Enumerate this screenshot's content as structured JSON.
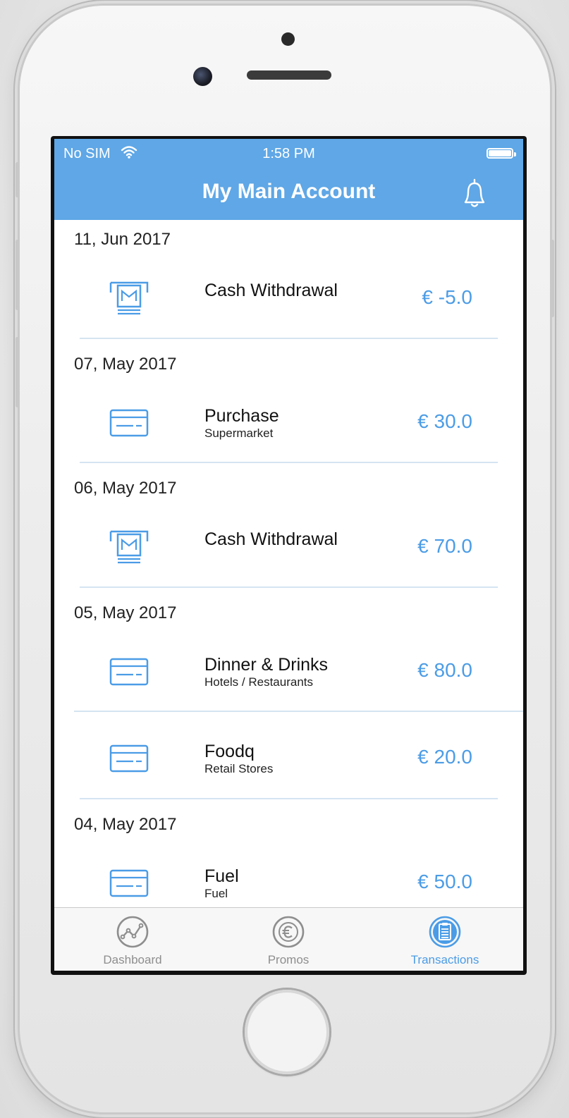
{
  "status_bar": {
    "carrier": "No SIM",
    "time": "1:58 PM"
  },
  "header": {
    "title": "My Main Account"
  },
  "transactions": [
    {
      "date": "11, Jun 2017",
      "title": "Cash Withdrawal",
      "subtitle": "",
      "amount": "€ -5.0",
      "icon": "atm-icon"
    },
    {
      "date": "07, May 2017",
      "title": "Purchase",
      "subtitle": "Supermarket",
      "amount": "€ 30.0",
      "icon": "card-icon"
    },
    {
      "date": "06, May 2017",
      "title": "Cash Withdrawal",
      "subtitle": "",
      "amount": "€ 70.0",
      "icon": "atm-icon"
    },
    {
      "date": "05, May 2017",
      "title": "Dinner & Drinks",
      "subtitle": "Hotels / Restaurants",
      "amount": "€ 80.0",
      "icon": "card-icon"
    },
    {
      "date": "",
      "title": "Foodq",
      "subtitle": "Retail Stores",
      "amount": "€ 20.0",
      "icon": "card-icon"
    },
    {
      "date": "04, May 2017",
      "title": "Fuel",
      "subtitle": "Fuel",
      "amount": "€ 50.0",
      "icon": "card-icon"
    }
  ],
  "tabs": [
    {
      "label": "Dashboard",
      "icon": "chart-icon",
      "active": false
    },
    {
      "label": "Promos",
      "icon": "euro-icon",
      "active": false
    },
    {
      "label": "Transactions",
      "icon": "clipboard-icon",
      "active": true
    }
  ],
  "colors": {
    "accent": "#5fa7e6",
    "amount": "#4b9ce6",
    "tab_inactive": "#8e8e8e"
  }
}
